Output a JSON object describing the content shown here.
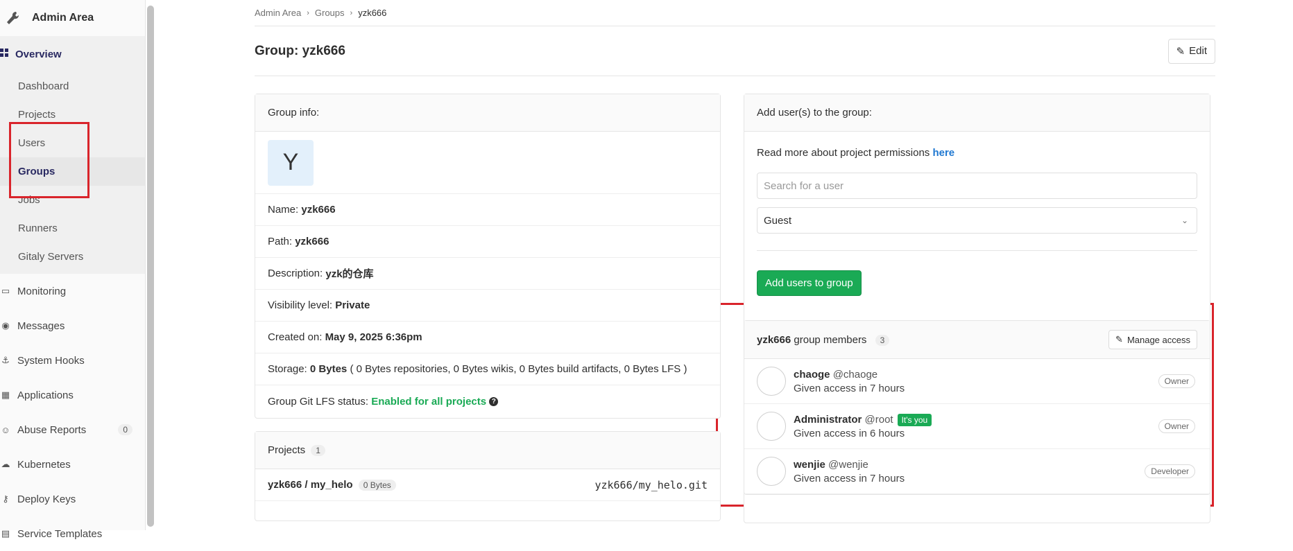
{
  "sidebar": {
    "title": "Admin Area",
    "overview_label": "Overview",
    "sub_items": [
      {
        "label": "Dashboard"
      },
      {
        "label": "Projects"
      },
      {
        "label": "Users"
      },
      {
        "label": "Groups"
      },
      {
        "label": "Jobs"
      },
      {
        "label": "Runners"
      },
      {
        "label": "Gitaly Servers"
      }
    ],
    "items": [
      {
        "label": "Monitoring",
        "icon": "monitor-icon"
      },
      {
        "label": "Messages",
        "icon": "broadcast-icon"
      },
      {
        "label": "System Hooks",
        "icon": "hook-icon"
      },
      {
        "label": "Applications",
        "icon": "grid-icon"
      },
      {
        "label": "Abuse Reports",
        "icon": "report-icon",
        "count": "0"
      },
      {
        "label": "Kubernetes",
        "icon": "cloud-icon"
      },
      {
        "label": "Deploy Keys",
        "icon": "key-icon"
      },
      {
        "label": "Service Templates",
        "icon": "template-icon"
      }
    ]
  },
  "breadcrumb": [
    "Admin Area",
    "Groups",
    "yzk666"
  ],
  "page": {
    "title": "Group: yzk666",
    "edit_label": "Edit"
  },
  "group_info": {
    "header": "Group info:",
    "avatar_letter": "Y",
    "name_label": "Name:",
    "name": "yzk666",
    "path_label": "Path:",
    "path": "yzk666",
    "desc_label": "Description:",
    "desc": "yzk的仓库",
    "vis_label": "Visibility level:",
    "vis": "Private",
    "created_label": "Created on:",
    "created": "May 9, 2025 6:36pm",
    "storage_label": "Storage:",
    "storage": "0 Bytes",
    "storage_detail": "( 0 Bytes repositories, 0 Bytes wikis, 0 Bytes build artifacts, 0 Bytes LFS )",
    "lfs_label": "Group Git LFS status:",
    "lfs": "Enabled for all projects"
  },
  "projects": {
    "header": "Projects",
    "count": "1",
    "rows": [
      {
        "name": "yzk666 / my_helo",
        "size": "0 Bytes",
        "path": "yzk666/my_helo.git"
      }
    ]
  },
  "add_users": {
    "header": "Add user(s) to the group:",
    "perm_text": "Read more about project permissions",
    "perm_link": "here",
    "search_placeholder": "Search for a user",
    "role_value": "Guest",
    "button": "Add users to group"
  },
  "members": {
    "group": "yzk666",
    "label": "group members",
    "count": "3",
    "manage_label": "Manage access",
    "rows": [
      {
        "name": "chaoge",
        "user": "@chaoge",
        "access": "Given access in 7 hours",
        "role": "Owner",
        "you": ""
      },
      {
        "name": "Administrator",
        "user": "@root",
        "access": "Given access in 6 hours",
        "role": "Owner",
        "you": "It's you"
      },
      {
        "name": "wenjie",
        "user": "@wenjie",
        "access": "Given access in 7 hours",
        "role": "Developer",
        "you": ""
      }
    ]
  },
  "colors": {
    "annotation": "#d9242b",
    "success": "#1aaa55",
    "link": "#1f78d1"
  }
}
